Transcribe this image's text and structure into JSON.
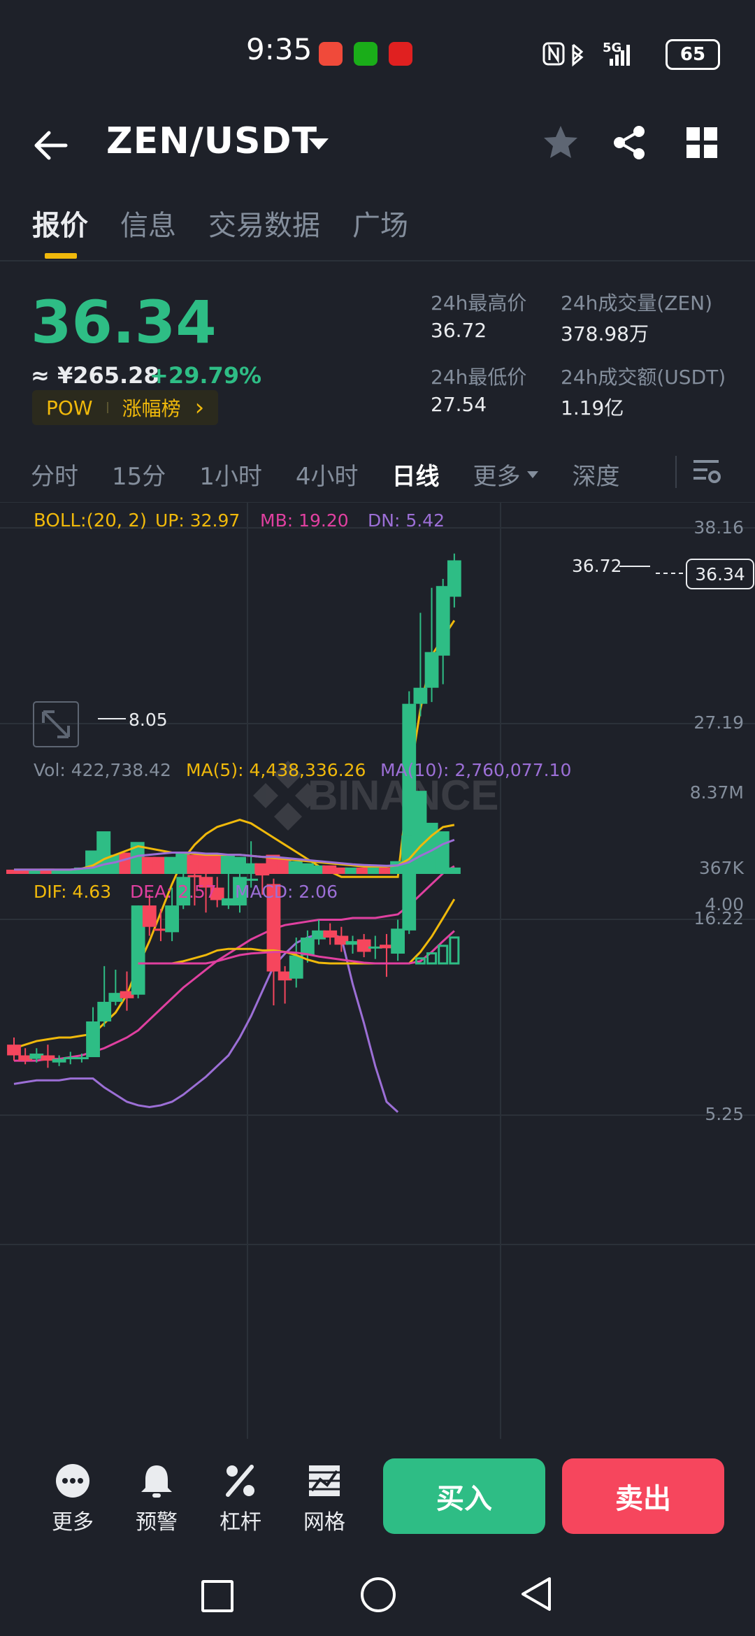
{
  "status_bar": {
    "time": "9:35",
    "battery": "65",
    "network": "5G"
  },
  "header": {
    "pair": "ZEN/USDT"
  },
  "tabs": [
    "报价",
    "信息",
    "交易数据",
    "广场"
  ],
  "price": {
    "last": "36.34",
    "cny": "≈ ¥265.28",
    "change": "+29.79%",
    "tag_left": "POW",
    "tag_right": "涨幅榜",
    "tag_arrow": "›"
  },
  "stats": {
    "high_label": "24h最高价",
    "high_value": "36.72",
    "vol_label": "24h成交量(ZEN)",
    "vol_value": "378.98万",
    "low_label": "24h最低价",
    "low_value": "27.54",
    "amount_label": "24h成交额(USDT)",
    "amount_value": "1.19亿"
  },
  "periods": [
    "分时",
    "15分",
    "1小时",
    "4小时",
    "日线",
    "更多",
    "深度"
  ],
  "boll": {
    "label": "BOLL:(20, 2)",
    "up": "UP: 32.97",
    "mb": "MB: 19.20",
    "dn": "DN: 5.42"
  },
  "price_axis": [
    "38.16",
    "27.19",
    "16.22",
    "5.25"
  ],
  "markers": {
    "high": "36.72",
    "low": "8.05",
    "current": "36.34"
  },
  "watermark": "BINANCE",
  "volume": {
    "vol": "Vol: 422,738.42",
    "ma5": "MA(5): 4,438,336.26",
    "ma10": "MA(10): 2,760,077.10",
    "axis_top": "8.37M",
    "axis_bottom": "367K"
  },
  "macd": {
    "dif": "DIF: 4.63",
    "dea": "DEA: 2.57",
    "macd": "MACD: 2.06",
    "axis_top": "4.00"
  },
  "toolbar": {
    "more": "更多",
    "alert": "预警",
    "leverage": "杠杆",
    "grid": "网格",
    "buy": "买入",
    "sell": "卖出"
  },
  "colors": {
    "up": "#2ebd85",
    "down": "#f6465d",
    "accent": "#f0b90b",
    "ma_pink": "#e040a0",
    "ma_purple": "#9c6fd6"
  },
  "chart_data": {
    "type": "candlestick",
    "ylim": [
      5.25,
      38.16
    ],
    "candles": [
      {
        "o": 9.2,
        "c": 8.6,
        "h": 9.6,
        "l": 8.3
      },
      {
        "o": 8.6,
        "c": 8.3,
        "h": 9.0,
        "l": 8.1
      },
      {
        "o": 8.4,
        "c": 8.7,
        "h": 9.0,
        "l": 8.2
      },
      {
        "o": 8.6,
        "c": 8.3,
        "h": 9.2,
        "l": 7.9
      },
      {
        "o": 8.2,
        "c": 8.4,
        "h": 8.6,
        "l": 8.0
      },
      {
        "o": 8.4,
        "c": 8.5,
        "h": 8.8,
        "l": 8.1
      },
      {
        "o": 8.4,
        "c": 8.5,
        "h": 8.7,
        "l": 8.2
      },
      {
        "o": 8.5,
        "c": 10.5,
        "h": 11.3,
        "l": 8.5
      },
      {
        "o": 10.5,
        "c": 11.6,
        "h": 13.6,
        "l": 10.2
      },
      {
        "o": 11.6,
        "c": 12.1,
        "h": 13.4,
        "l": 11.4
      },
      {
        "o": 12.2,
        "c": 11.8,
        "h": 13.3,
        "l": 11.1
      },
      {
        "o": 12.0,
        "c": 17.0,
        "h": 17.0,
        "l": 11.8
      },
      {
        "o": 17.0,
        "c": 15.8,
        "h": 17.6,
        "l": 15.3
      },
      {
        "o": 15.7,
        "c": 15.6,
        "h": 16.8,
        "l": 15.0
      },
      {
        "o": 15.5,
        "c": 17.0,
        "h": 18.0,
        "l": 15.0
      },
      {
        "o": 17.0,
        "c": 18.6,
        "h": 19.9,
        "l": 16.8
      },
      {
        "o": 18.7,
        "c": 18.6,
        "h": 19.6,
        "l": 17.0
      },
      {
        "o": 18.6,
        "c": 18.0,
        "h": 19.1,
        "l": 16.6
      },
      {
        "o": 18.0,
        "c": 17.3,
        "h": 18.6,
        "l": 16.9
      },
      {
        "o": 17.0,
        "c": 17.4,
        "h": 18.8,
        "l": 16.8
      },
      {
        "o": 17.0,
        "c": 18.6,
        "h": 18.8,
        "l": 16.6
      },
      {
        "o": 18.5,
        "c": 18.5,
        "h": 20.6,
        "l": 18.0
      },
      {
        "o": 18.8,
        "c": 18.7,
        "h": 19.1,
        "l": 17.6
      },
      {
        "o": 18.2,
        "c": 13.3,
        "h": 18.5,
        "l": 11.4
      },
      {
        "o": 13.3,
        "c": 12.8,
        "h": 13.6,
        "l": 11.5
      },
      {
        "o": 12.9,
        "c": 14.2,
        "h": 15.2,
        "l": 12.4
      },
      {
        "o": 14.2,
        "c": 15.2,
        "h": 15.6,
        "l": 13.8
      },
      {
        "o": 15.1,
        "c": 15.6,
        "h": 16.2,
        "l": 14.8
      },
      {
        "o": 15.6,
        "c": 15.2,
        "h": 16.0,
        "l": 14.8
      },
      {
        "o": 15.3,
        "c": 14.8,
        "h": 15.8,
        "l": 14.4
      },
      {
        "o": 14.8,
        "c": 15.0,
        "h": 15.3,
        "l": 14.3
      },
      {
        "o": 15.1,
        "c": 14.4,
        "h": 15.4,
        "l": 14.1
      },
      {
        "o": 14.6,
        "c": 14.7,
        "h": 15.3,
        "l": 14.0
      },
      {
        "o": 14.8,
        "c": 14.6,
        "h": 15.4,
        "l": 13.0
      },
      {
        "o": 14.3,
        "c": 15.7,
        "h": 16.2,
        "l": 13.9
      },
      {
        "o": 15.6,
        "c": 28.3,
        "h": 29.0,
        "l": 15.4
      },
      {
        "o": 28.3,
        "c": 29.2,
        "h": 33.4,
        "l": 27.6
      },
      {
        "o": 29.2,
        "c": 31.2,
        "h": 34.8,
        "l": 28.4
      },
      {
        "o": 31.0,
        "c": 34.9,
        "h": 35.3,
        "l": 29.4
      },
      {
        "o": 34.3,
        "c": 36.34,
        "h": 36.72,
        "l": 33.7
      }
    ],
    "boll_up": [
      9.0,
      9.2,
      9.4,
      9.5,
      9.6,
      9.6,
      9.7,
      9.8,
      10.4,
      11.0,
      12.0,
      13.6,
      15.0,
      16.6,
      18.2,
      19.6,
      20.4,
      21.0,
      21.4,
      21.6,
      21.8,
      21.6,
      21.2,
      20.8,
      20.4,
      20.0,
      19.6,
      19.2,
      18.9,
      18.6,
      18.6,
      18.6,
      18.6,
      18.6,
      18.6,
      24.0,
      28.0,
      31.0,
      32.0,
      32.97
    ],
    "boll_mb": [
      8.3,
      8.3,
      8.3,
      8.4,
      8.4,
      8.5,
      8.6,
      8.8,
      9.0,
      9.3,
      9.6,
      10.0,
      10.6,
      11.2,
      11.8,
      12.4,
      12.9,
      13.4,
      13.9,
      14.3,
      14.7,
      15.1,
      15.4,
      15.7,
      15.9,
      16.0,
      16.1,
      16.2,
      16.2,
      16.2,
      16.3,
      16.3,
      16.3,
      16.4,
      16.5,
      17.0,
      17.6,
      18.2,
      18.8,
      19.2
    ],
    "boll_dn": [
      7.0,
      7.1,
      7.2,
      7.2,
      7.2,
      7.3,
      7.3,
      7.3,
      6.8,
      6.4,
      6.0,
      5.8,
      5.7,
      5.8,
      6.0,
      6.4,
      6.9,
      7.4,
      8.0,
      8.6,
      9.6,
      10.8,
      12.2,
      13.6,
      14.3,
      14.9,
      15.2,
      15.4,
      15.4,
      15.2,
      12.6,
      10.4,
      8.0,
      6.0,
      5.42
    ],
    "volume": [
      0.2,
      0.2,
      0.2,
      0.25,
      0.2,
      0.2,
      0.3,
      1.1,
      2.0,
      0.9,
      1.0,
      1.5,
      0.8,
      0.8,
      0.8,
      1.0,
      0.9,
      0.9,
      0.9,
      0.9,
      0.8,
      0.5,
      0.5,
      0.9,
      0.7,
      0.6,
      0.5,
      0.4,
      0.4,
      0.3,
      0.3,
      0.3,
      0.3,
      0.3,
      0.6,
      1.8,
      3.9,
      2.4,
      2.0,
      0.3
    ],
    "vol_ma5": [
      0.2,
      0.2,
      0.2,
      0.2,
      0.2,
      0.2,
      0.25,
      0.4,
      0.7,
      0.9,
      1.1,
      1.3,
      1.2,
      1.1,
      1.0,
      1.0,
      0.95,
      0.9,
      0.9,
      0.9,
      0.9,
      0.85,
      0.8,
      0.75,
      0.7,
      0.65,
      0.6,
      0.55,
      0.5,
      0.45,
      0.4,
      0.35,
      0.35,
      0.35,
      0.4,
      0.7,
      1.3,
      1.8,
      2.2,
      2.3
    ],
    "vol_ma10": [
      0.2,
      0.2,
      0.2,
      0.2,
      0.2,
      0.2,
      0.25,
      0.3,
      0.45,
      0.55,
      0.7,
      0.85,
      0.9,
      0.95,
      1.0,
      1.0,
      1.0,
      0.95,
      0.95,
      0.9,
      0.9,
      0.85,
      0.8,
      0.8,
      0.75,
      0.7,
      0.65,
      0.6,
      0.55,
      0.5,
      0.45,
      0.42,
      0.4,
      0.38,
      0.4,
      0.55,
      0.85,
      1.1,
      1.4,
      1.6
    ],
    "macd_dif": [
      -0.8,
      -0.6,
      -0.2,
      0.2,
      0.6,
      0.8,
      1.0,
      1.3,
      1.4,
      1.4,
      1.4,
      1.3,
      1.3,
      1.2,
      1.0,
      0.7,
      0.5,
      0.3,
      0.2,
      0.1,
      0.0,
      -0.1,
      -0.2,
      -0.3,
      0.2,
      1.2,
      2.2,
      3.4,
      4.63
    ],
    "macd_dea": [
      -1.2,
      -1.0,
      -0.8,
      -0.5,
      -0.2,
      0.1,
      0.4,
      0.6,
      0.8,
      1.0,
      1.1,
      1.15,
      1.2,
      1.2,
      1.15,
      1.05,
      0.9,
      0.8,
      0.7,
      0.6,
      0.5,
      0.4,
      0.3,
      0.2,
      0.2,
      0.6,
      1.2,
      1.9,
      2.57
    ]
  }
}
